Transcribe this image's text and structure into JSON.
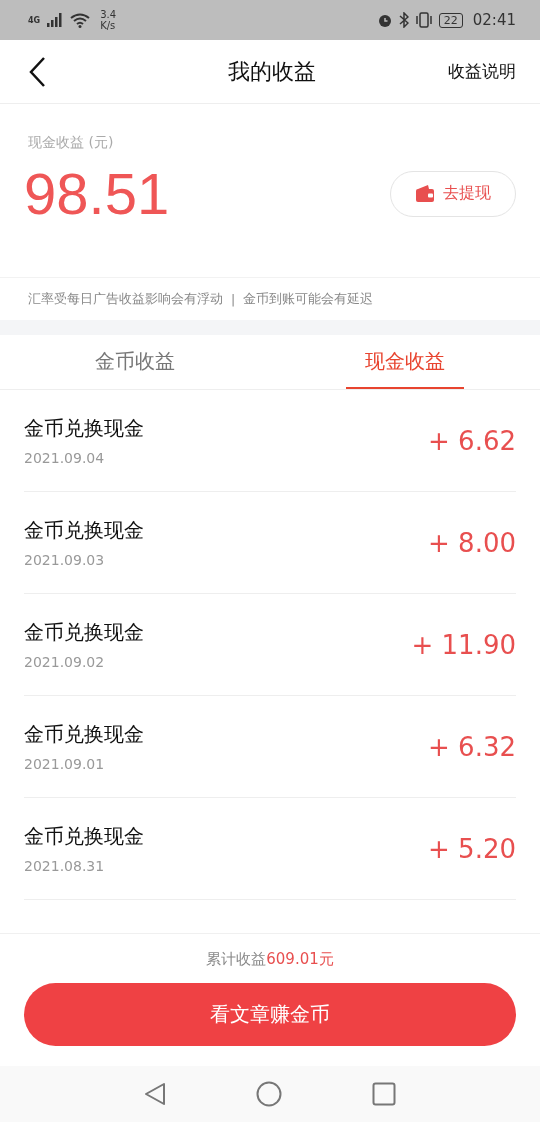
{
  "status_bar": {
    "network": "4G",
    "speed": "3.4",
    "speed_unit": "K/s",
    "battery": "22",
    "time": "02:41"
  },
  "header": {
    "title": "我的收益",
    "action": "收益说明"
  },
  "summary": {
    "label": "现金收益 (元)",
    "amount": "98.51",
    "withdraw_button": "去提现"
  },
  "notice": {
    "left": "汇率受每日广告收益影响会有浮动",
    "separator": "|",
    "right": "金币到账可能会有延迟"
  },
  "tabs": [
    {
      "label": "金币收益",
      "selected": false
    },
    {
      "label": "现金收益",
      "selected": true
    }
  ],
  "records": [
    {
      "title": "金币兑换现金",
      "date": "2021.09.04",
      "amount": "+ 6.62"
    },
    {
      "title": "金币兑换现金",
      "date": "2021.09.03",
      "amount": "+ 8.00"
    },
    {
      "title": "金币兑换现金",
      "date": "2021.09.02",
      "amount": "+ 11.90"
    },
    {
      "title": "金币兑换现金",
      "date": "2021.09.01",
      "amount": "+ 6.32"
    },
    {
      "title": "金币兑换现金",
      "date": "2021.08.31",
      "amount": "+ 5.20"
    }
  ],
  "footer": {
    "total_label": "累计收益",
    "total_value": "609.01元",
    "button": "看文章赚金币"
  }
}
